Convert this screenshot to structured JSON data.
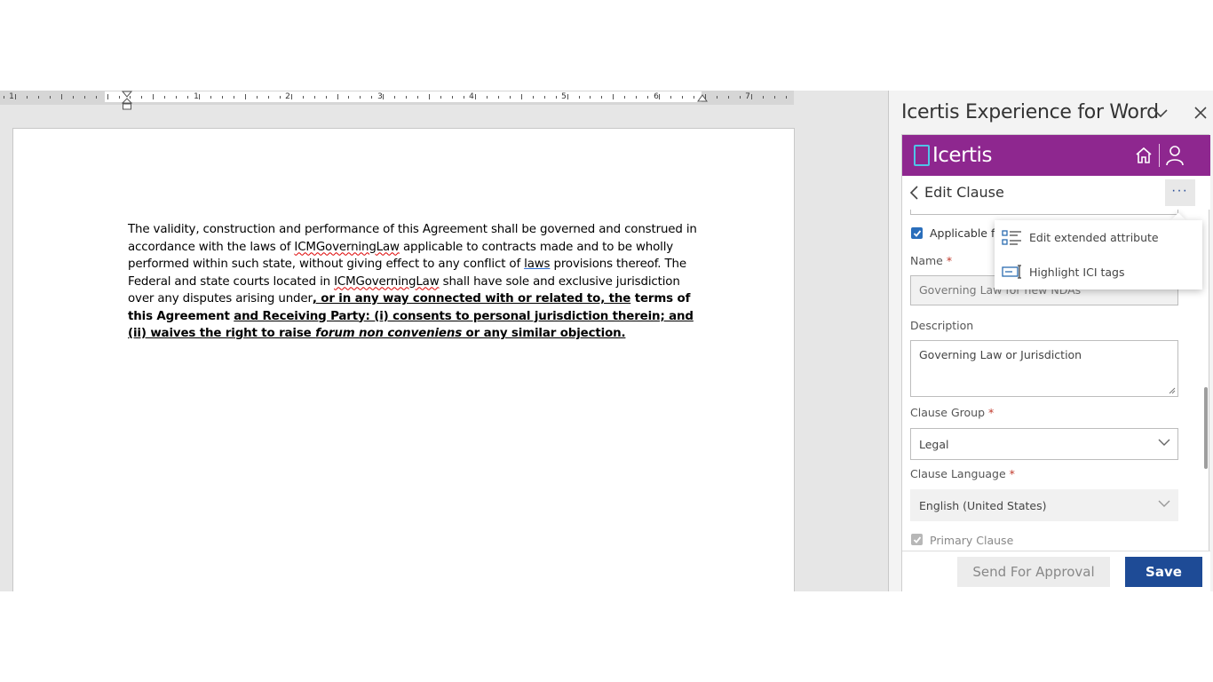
{
  "ruler": {
    "numbers": [
      "1",
      "1",
      "2",
      "3",
      "4",
      "5",
      "6",
      "7"
    ]
  },
  "document": {
    "p1": "The validity, construction and performance of this Agreement shall be governed and construed in accordance with the laws of ",
    "tag1": "ICMGoverningLaw",
    "p2": " applicable to contracts made and to be wholly performed within such state, without giving effect to any conflict of ",
    "laws": "laws",
    "p3": " provisions thereof.  The Federal and state courts located in ",
    "tag2": "ICMGoverningLaw",
    "p4": " shall have sole and exclusive jurisdiction over any disputes arising under",
    "u1": ", or in any way connected with or related to,  the",
    "b1": " terms of this Agreement ",
    "u2": "and Receiving Party: (i) consents to personal jurisdiction therein; and (ii) waives the right to raise ",
    "italic": "forum non conveniens",
    "u3": " or any similar objection."
  },
  "pane": {
    "title": "Icertis Experience for Word",
    "brand": "Icertis",
    "edit_title": "Edit Clause",
    "more": "···"
  },
  "menu": {
    "items": [
      {
        "label": "Edit extended attribute",
        "icon": "attribute-list-icon"
      },
      {
        "label": "Highlight ICI tags",
        "icon": "tag-highlight-icon"
      }
    ]
  },
  "form": {
    "applicable_label": "Applicable fo",
    "applicable_checked": true,
    "name_label": "Name",
    "name_value": "Governing Law for new NDAs",
    "description_label": "Description",
    "description_value": "Governing Law or Jurisdiction",
    "group_label": "Clause Group",
    "group_value": "Legal",
    "language_label": "Clause Language",
    "language_value": "English (United States)",
    "primary_label": "Primary Clause",
    "primary_checked": true,
    "required_mark": "*"
  },
  "footer": {
    "approval_label": "Send For Approval",
    "save_label": "Save"
  },
  "colors": {
    "brand_purple": "#8e278f",
    "save_blue": "#1e4b96",
    "checkbox_blue": "#2a6ebb"
  }
}
